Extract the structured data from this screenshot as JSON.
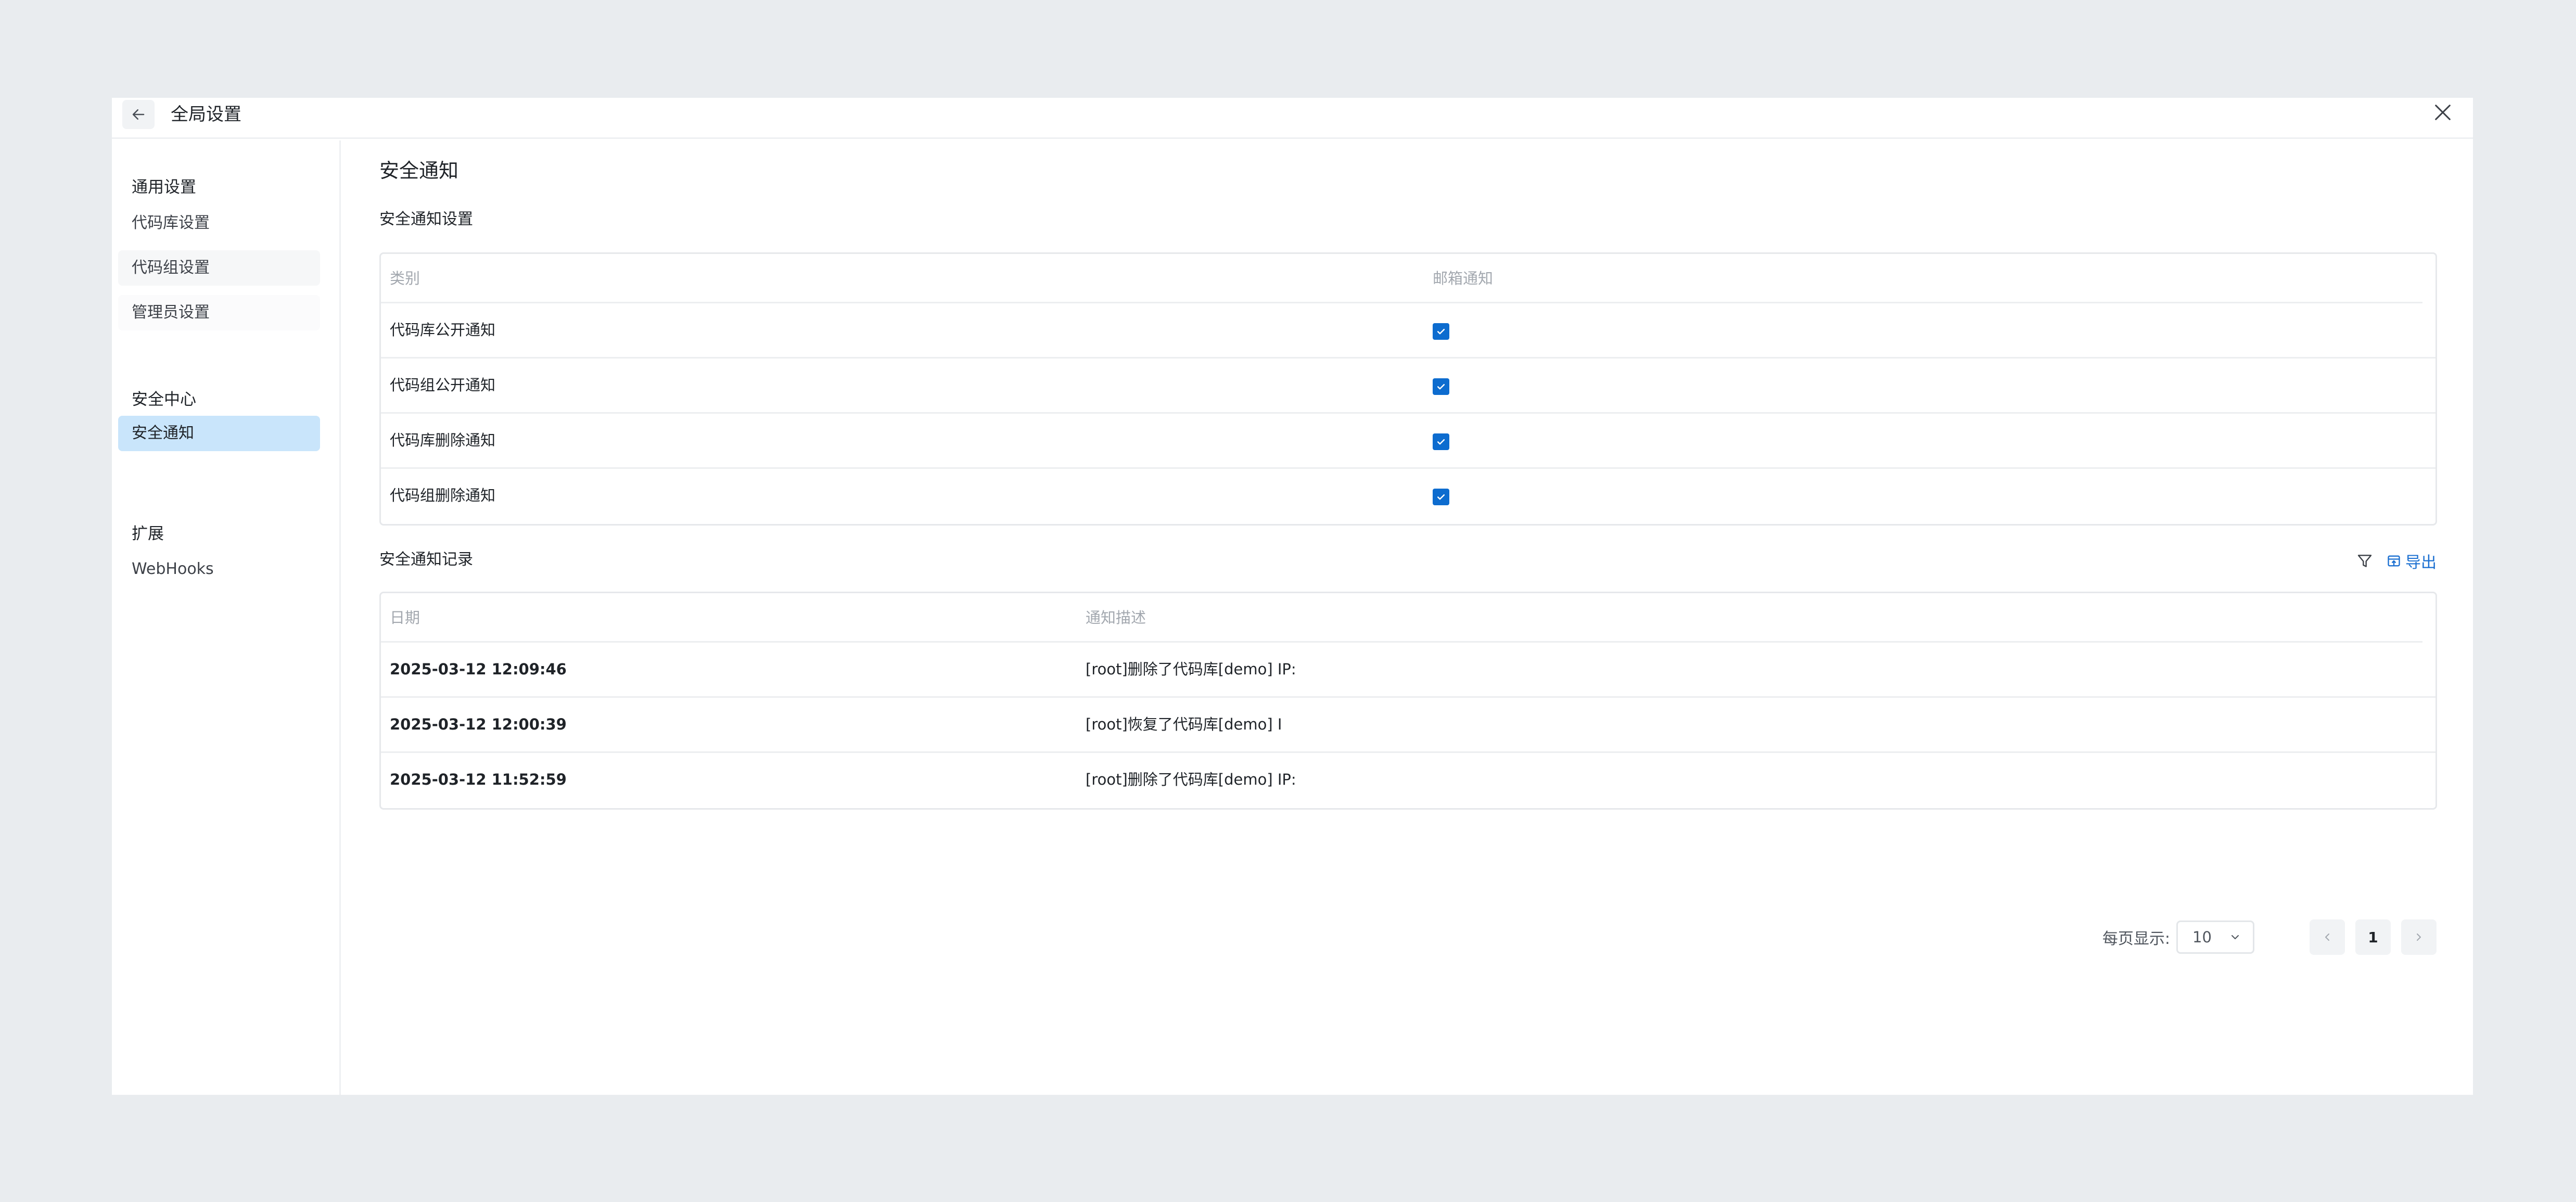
{
  "header": {
    "title": "全局设置"
  },
  "sidebar": {
    "groups": [
      {
        "title": "通用设置",
        "items": [
          {
            "label": "代码库设置"
          },
          {
            "label": "代码组设置"
          },
          {
            "label": "管理员设置"
          }
        ]
      },
      {
        "title": "安全中心",
        "items": [
          {
            "label": "安全通知"
          }
        ]
      },
      {
        "title": "扩展",
        "items": [
          {
            "label": "WebHooks"
          }
        ]
      }
    ],
    "active_item": "安全通知"
  },
  "main": {
    "page_title": "安全通知",
    "settings": {
      "title": "安全通知设置",
      "columns": [
        "类别",
        "邮箱通知"
      ],
      "rows": [
        {
          "category": "代码库公开通知",
          "email": true
        },
        {
          "category": "代码组公开通知",
          "email": true
        },
        {
          "category": "代码库删除通知",
          "email": true
        },
        {
          "category": "代码组删除通知",
          "email": true
        }
      ]
    },
    "records": {
      "title": "安全通知记录",
      "export_label": "导出",
      "columns": [
        "日期",
        "通知描述"
      ],
      "rows": [
        {
          "date": "2025-03-12 12:09:46",
          "desc": "[root]删除了代码库[demo] IP:"
        },
        {
          "date": "2025-03-12 12:00:39",
          "desc": "[root]恢复了代码库[demo] I"
        },
        {
          "date": "2025-03-12 11:52:59",
          "desc": "[root]删除了代码库[demo] IP:"
        }
      ]
    },
    "pagination": {
      "label": "每页显示:",
      "page_size": "10",
      "current_page": "1"
    }
  },
  "colors": {
    "accent": "#0d6ccf",
    "active_bg": "#c9e5fb",
    "link": "#1a6fd1"
  },
  "icons": {
    "back": "arrow-left-icon",
    "close": "close-icon",
    "filter": "filter-icon",
    "export": "export-icon",
    "check": "check-icon",
    "dropdown": "chevron-down-icon",
    "prev": "chevron-left-icon",
    "next": "chevron-right-icon"
  }
}
